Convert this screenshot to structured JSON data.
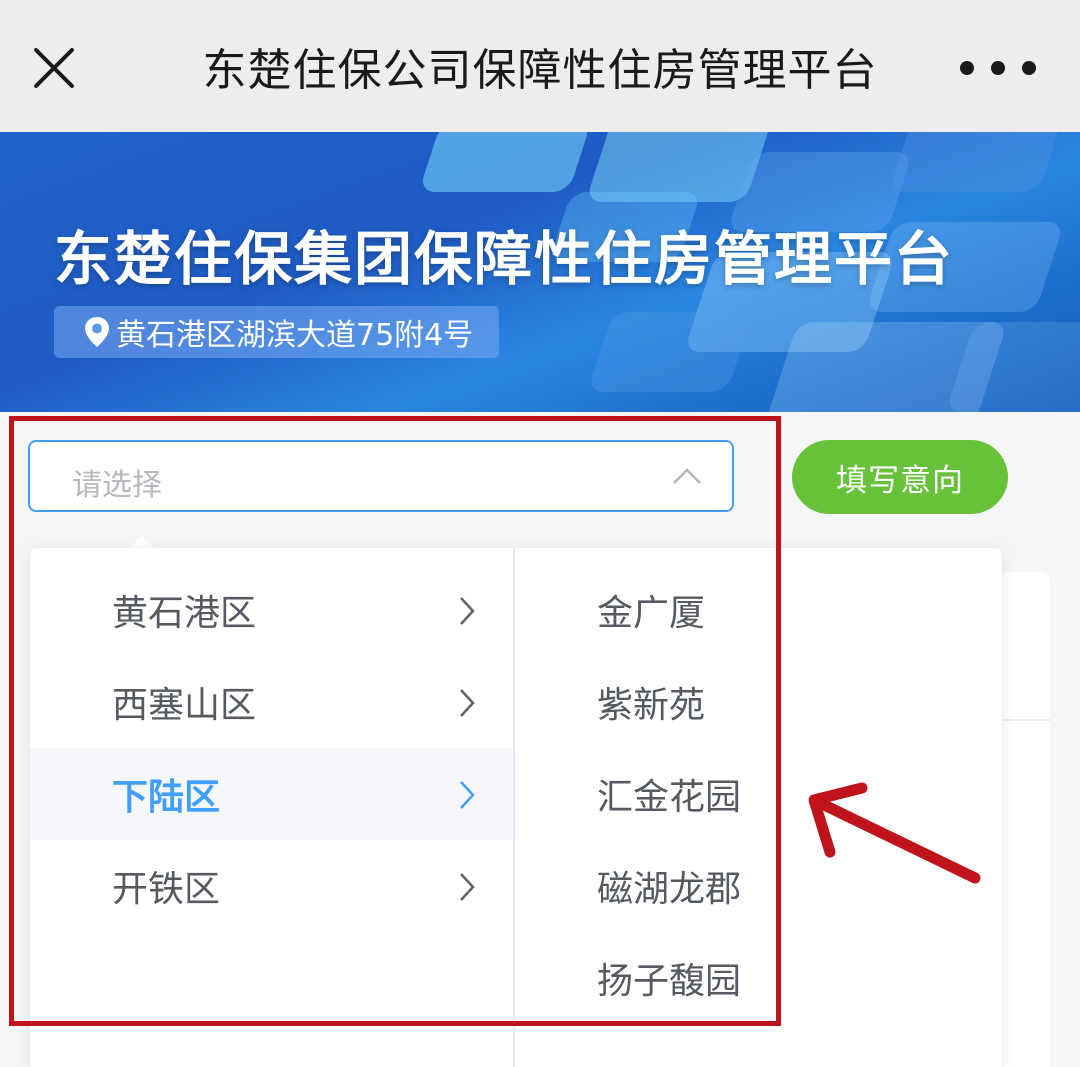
{
  "navbar": {
    "title": "东楚住保公司保障性住房管理平台",
    "close_icon": "close-icon",
    "more_icon": "more-dots-icon"
  },
  "banner": {
    "title": "东楚住保集团保障性住房管理平台",
    "address": "黄石港区湖滨大道75附4号",
    "location_icon": "location-pin-icon"
  },
  "form": {
    "select_placeholder": "请选择",
    "submit_label": "填写意向"
  },
  "cascader": {
    "districts": [
      {
        "label": "黄石港区",
        "active": false
      },
      {
        "label": "西塞山区",
        "active": false
      },
      {
        "label": "下陆区",
        "active": true
      },
      {
        "label": "开铁区",
        "active": false
      }
    ],
    "communities": [
      "金广厦",
      "紫新苑",
      "汇金花园",
      "磁湖龙郡",
      "扬子馥园"
    ]
  },
  "colors": {
    "primary": "#409eff",
    "success": "#67c23a",
    "annotation": "#c0141c",
    "banner": "#1f63c8"
  }
}
